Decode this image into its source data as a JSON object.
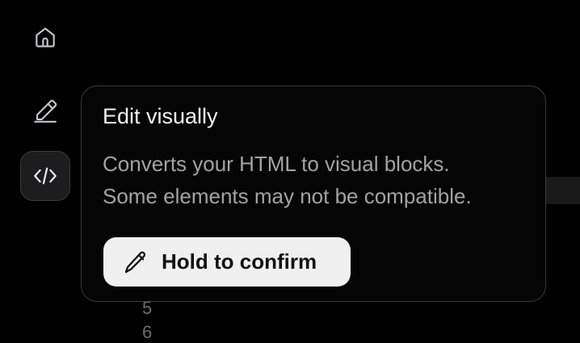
{
  "rail": {
    "items": [
      {
        "icon": "home-icon",
        "active": false
      },
      {
        "icon": "pencil-icon",
        "active": false
      },
      {
        "icon": "code-icon",
        "active": true
      }
    ]
  },
  "editor": {
    "line_numbers": [
      "5",
      "6"
    ]
  },
  "popover": {
    "title": "Edit visually",
    "body_line1": "Converts your HTML to visual blocks.",
    "body_line2": "Some elements may not be compatible.",
    "confirm_label": "Hold to confirm",
    "confirm_icon": "pencil-icon"
  },
  "colors": {
    "background": "#000000",
    "popover_border": "#3a3a3c",
    "button_bg": "#f0f0f0",
    "muted_text": "#a3a3a6"
  }
}
